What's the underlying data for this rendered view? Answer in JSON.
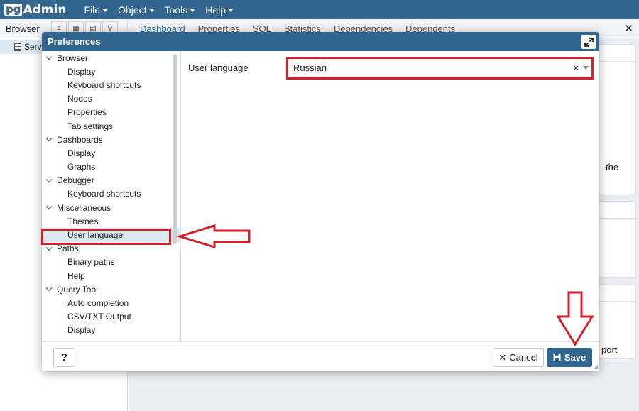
{
  "app": {
    "logo_pg": "pg",
    "logo_admin": "Admin"
  },
  "menu": [
    "File",
    "Object",
    "Tools",
    "Help"
  ],
  "browser": {
    "title": "Browser",
    "tree_item": "Serv"
  },
  "tabs": [
    "Dashboard",
    "Properties",
    "SQL",
    "Statistics",
    "Dependencies",
    "Dependents"
  ],
  "background_fragments": {
    "the": "the",
    "port": "port"
  },
  "modal": {
    "title": "Preferences",
    "tree": [
      {
        "label": "Browser",
        "level": "parent"
      },
      {
        "label": "Display",
        "level": "child"
      },
      {
        "label": "Keyboard shortcuts",
        "level": "child"
      },
      {
        "label": "Nodes",
        "level": "child"
      },
      {
        "label": "Properties",
        "level": "child"
      },
      {
        "label": "Tab settings",
        "level": "child"
      },
      {
        "label": "Dashboards",
        "level": "parent"
      },
      {
        "label": "Display",
        "level": "child"
      },
      {
        "label": "Graphs",
        "level": "child"
      },
      {
        "label": "Debugger",
        "level": "parent"
      },
      {
        "label": "Keyboard shortcuts",
        "level": "child"
      },
      {
        "label": "Miscellaneous",
        "level": "parent"
      },
      {
        "label": "Themes",
        "level": "child"
      },
      {
        "label": "User language",
        "level": "child",
        "selected": true
      },
      {
        "label": "Paths",
        "level": "parent"
      },
      {
        "label": "Binary paths",
        "level": "child"
      },
      {
        "label": "Help",
        "level": "child"
      },
      {
        "label": "Query Tool",
        "level": "parent"
      },
      {
        "label": "Auto completion",
        "level": "child"
      },
      {
        "label": "CSV/TXT Output",
        "level": "child"
      },
      {
        "label": "Display",
        "level": "child"
      }
    ],
    "field": {
      "label": "User language",
      "value": "Russian",
      "clear": "×"
    },
    "footer": {
      "help": "?",
      "cancel": "Cancel",
      "save": "Save"
    }
  },
  "colors": {
    "primary": "#326690",
    "annotation": "#d4202a",
    "selected": "#dbe7f1"
  }
}
